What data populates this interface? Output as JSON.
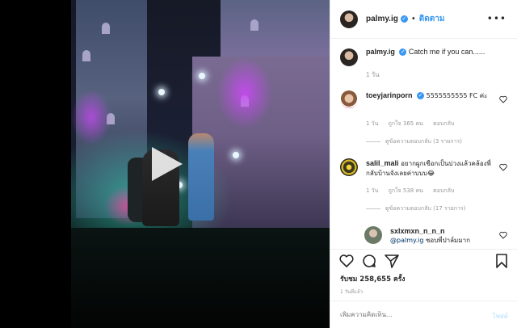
{
  "post": {
    "username": "palmy.ig",
    "follow_label": "ติดตาม",
    "more_label": "•••",
    "caption_text": "Catch me if you can......",
    "caption_time": "1 วัน"
  },
  "comments": [
    {
      "username": "toeyjarinporn",
      "text": "5555555555 FC ค่ะ",
      "time": "1 วัน",
      "likes": "ถูกใจ 365 คน",
      "reply": "ตอบกลับ",
      "replies": "ดูข้อความตอบกลับ (3 รายการ)"
    },
    {
      "username": "salil_mali",
      "text": "อยากผูกเชือกเป็นบ่วงแล้วคล้องพี่กลับบ้านจังเลยค่าบบบ😂",
      "time": "1 วัน",
      "likes": "ถูกใจ 538 คน",
      "reply": "ตอบกลับ",
      "replies": "ดูข้อความตอบกลับ (17 รายการ)"
    },
    {
      "username": "sxlxmxn_n_n_n",
      "mention": "@palmy.ig",
      "text": "ชอบพี่ปาล์มมาก"
    }
  ],
  "likes_text": "รับชม 258,655 ครั้ง",
  "post_date": "1 วันที่แล้ว",
  "comment_box": {
    "placeholder": "เพิ่มความคิดเห็น...",
    "post_label": "โพสต์"
  },
  "colors": {
    "link": "#3897f0",
    "text": "#262626",
    "muted": "#999999"
  }
}
